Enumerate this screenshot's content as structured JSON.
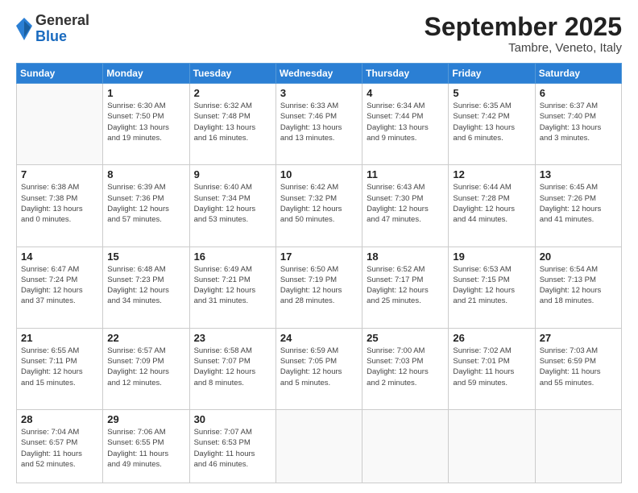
{
  "logo": {
    "general": "General",
    "blue": "Blue"
  },
  "header": {
    "month": "September 2025",
    "location": "Tambre, Veneto, Italy"
  },
  "days_of_week": [
    "Sunday",
    "Monday",
    "Tuesday",
    "Wednesday",
    "Thursday",
    "Friday",
    "Saturday"
  ],
  "weeks": [
    [
      {
        "day": "",
        "info": ""
      },
      {
        "day": "1",
        "info": "Sunrise: 6:30 AM\nSunset: 7:50 PM\nDaylight: 13 hours\nand 19 minutes."
      },
      {
        "day": "2",
        "info": "Sunrise: 6:32 AM\nSunset: 7:48 PM\nDaylight: 13 hours\nand 16 minutes."
      },
      {
        "day": "3",
        "info": "Sunrise: 6:33 AM\nSunset: 7:46 PM\nDaylight: 13 hours\nand 13 minutes."
      },
      {
        "day": "4",
        "info": "Sunrise: 6:34 AM\nSunset: 7:44 PM\nDaylight: 13 hours\nand 9 minutes."
      },
      {
        "day": "5",
        "info": "Sunrise: 6:35 AM\nSunset: 7:42 PM\nDaylight: 13 hours\nand 6 minutes."
      },
      {
        "day": "6",
        "info": "Sunrise: 6:37 AM\nSunset: 7:40 PM\nDaylight: 13 hours\nand 3 minutes."
      }
    ],
    [
      {
        "day": "7",
        "info": "Sunrise: 6:38 AM\nSunset: 7:38 PM\nDaylight: 13 hours\nand 0 minutes."
      },
      {
        "day": "8",
        "info": "Sunrise: 6:39 AM\nSunset: 7:36 PM\nDaylight: 12 hours\nand 57 minutes."
      },
      {
        "day": "9",
        "info": "Sunrise: 6:40 AM\nSunset: 7:34 PM\nDaylight: 12 hours\nand 53 minutes."
      },
      {
        "day": "10",
        "info": "Sunrise: 6:42 AM\nSunset: 7:32 PM\nDaylight: 12 hours\nand 50 minutes."
      },
      {
        "day": "11",
        "info": "Sunrise: 6:43 AM\nSunset: 7:30 PM\nDaylight: 12 hours\nand 47 minutes."
      },
      {
        "day": "12",
        "info": "Sunrise: 6:44 AM\nSunset: 7:28 PM\nDaylight: 12 hours\nand 44 minutes."
      },
      {
        "day": "13",
        "info": "Sunrise: 6:45 AM\nSunset: 7:26 PM\nDaylight: 12 hours\nand 41 minutes."
      }
    ],
    [
      {
        "day": "14",
        "info": "Sunrise: 6:47 AM\nSunset: 7:24 PM\nDaylight: 12 hours\nand 37 minutes."
      },
      {
        "day": "15",
        "info": "Sunrise: 6:48 AM\nSunset: 7:23 PM\nDaylight: 12 hours\nand 34 minutes."
      },
      {
        "day": "16",
        "info": "Sunrise: 6:49 AM\nSunset: 7:21 PM\nDaylight: 12 hours\nand 31 minutes."
      },
      {
        "day": "17",
        "info": "Sunrise: 6:50 AM\nSunset: 7:19 PM\nDaylight: 12 hours\nand 28 minutes."
      },
      {
        "day": "18",
        "info": "Sunrise: 6:52 AM\nSunset: 7:17 PM\nDaylight: 12 hours\nand 25 minutes."
      },
      {
        "day": "19",
        "info": "Sunrise: 6:53 AM\nSunset: 7:15 PM\nDaylight: 12 hours\nand 21 minutes."
      },
      {
        "day": "20",
        "info": "Sunrise: 6:54 AM\nSunset: 7:13 PM\nDaylight: 12 hours\nand 18 minutes."
      }
    ],
    [
      {
        "day": "21",
        "info": "Sunrise: 6:55 AM\nSunset: 7:11 PM\nDaylight: 12 hours\nand 15 minutes."
      },
      {
        "day": "22",
        "info": "Sunrise: 6:57 AM\nSunset: 7:09 PM\nDaylight: 12 hours\nand 12 minutes."
      },
      {
        "day": "23",
        "info": "Sunrise: 6:58 AM\nSunset: 7:07 PM\nDaylight: 12 hours\nand 8 minutes."
      },
      {
        "day": "24",
        "info": "Sunrise: 6:59 AM\nSunset: 7:05 PM\nDaylight: 12 hours\nand 5 minutes."
      },
      {
        "day": "25",
        "info": "Sunrise: 7:00 AM\nSunset: 7:03 PM\nDaylight: 12 hours\nand 2 minutes."
      },
      {
        "day": "26",
        "info": "Sunrise: 7:02 AM\nSunset: 7:01 PM\nDaylight: 11 hours\nand 59 minutes."
      },
      {
        "day": "27",
        "info": "Sunrise: 7:03 AM\nSunset: 6:59 PM\nDaylight: 11 hours\nand 55 minutes."
      }
    ],
    [
      {
        "day": "28",
        "info": "Sunrise: 7:04 AM\nSunset: 6:57 PM\nDaylight: 11 hours\nand 52 minutes."
      },
      {
        "day": "29",
        "info": "Sunrise: 7:06 AM\nSunset: 6:55 PM\nDaylight: 11 hours\nand 49 minutes."
      },
      {
        "day": "30",
        "info": "Sunrise: 7:07 AM\nSunset: 6:53 PM\nDaylight: 11 hours\nand 46 minutes."
      },
      {
        "day": "",
        "info": ""
      },
      {
        "day": "",
        "info": ""
      },
      {
        "day": "",
        "info": ""
      },
      {
        "day": "",
        "info": ""
      }
    ]
  ]
}
